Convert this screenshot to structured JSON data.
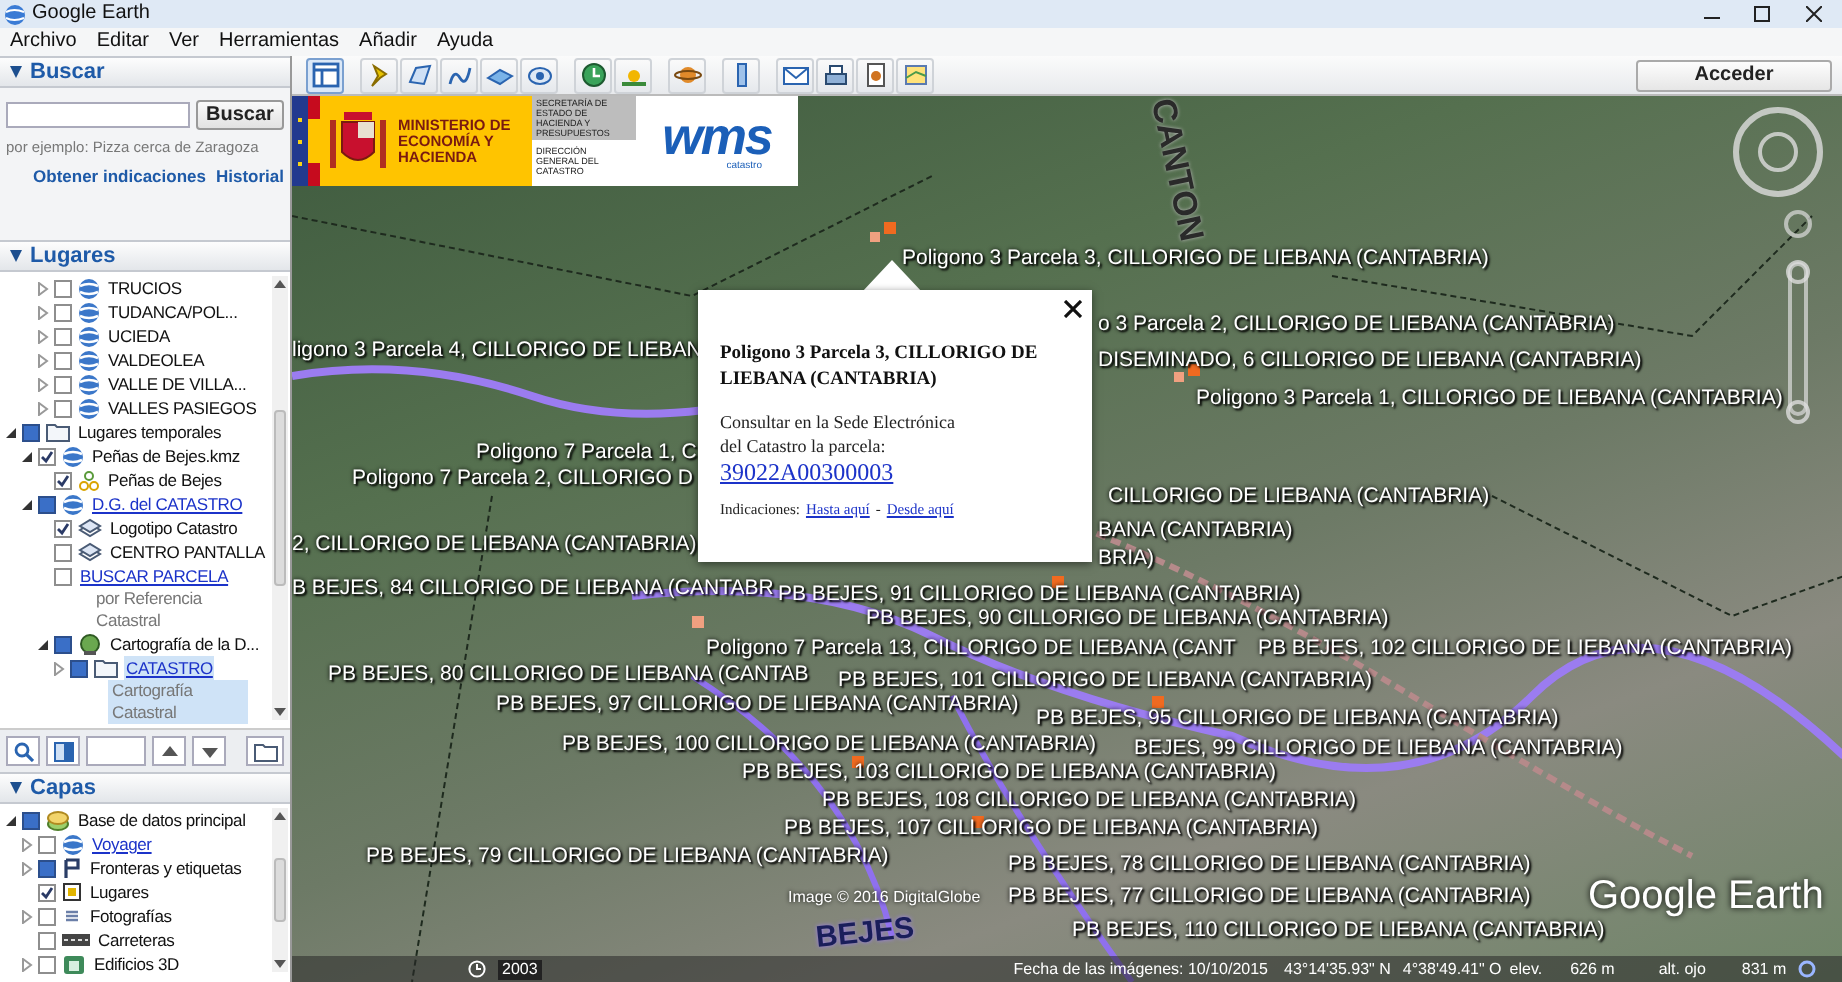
{
  "window": {
    "title": "Google Earth"
  },
  "menu": [
    "Archivo",
    "Editar",
    "Ver",
    "Herramientas",
    "Añadir",
    "Ayuda"
  ],
  "toolbar": {
    "sidebar_selected": true
  },
  "account_button": "Acceder",
  "search": {
    "title": "Buscar",
    "expanded": true,
    "button": "Buscar",
    "hint": "por ejemplo: Pizza cerca de Zaragoza",
    "links": [
      "Obtener indicaciones",
      "Historial"
    ]
  },
  "places": {
    "title": "Lugares",
    "expanded": true,
    "scrolled_children": [
      {
        "label": "TRUCIOS",
        "kind": "kml",
        "checked": false,
        "expanded": false
      },
      {
        "label": "TUDANCA/POL...",
        "kind": "kml",
        "checked": false,
        "expanded": false
      },
      {
        "label": "UCIEDA",
        "kind": "kml",
        "checked": false,
        "expanded": false
      },
      {
        "label": "VALDEOLEA",
        "kind": "kml",
        "checked": false,
        "expanded": false
      },
      {
        "label": "VALLE DE VILLA...",
        "kind": "kml",
        "checked": false,
        "expanded": false
      },
      {
        "label": "VALLES PASIEGOS",
        "kind": "kml",
        "checked": false,
        "expanded": false
      }
    ],
    "tree": [
      {
        "label": "Lugares temporales",
        "kind": "folder",
        "mixed": true,
        "expanded": true,
        "link": false,
        "selected": false,
        "children": [
          {
            "label": "Peñas de Bejes.kmz",
            "kind": "kml",
            "checked": true,
            "expanded": true,
            "link": false,
            "selected": false,
            "children": [
              {
                "label": "Peñas de Bejes",
                "kind": "points",
                "checked": true,
                "link": false,
                "selected": false
              }
            ]
          },
          {
            "label": "D.G. del CATASTRO",
            "kind": "kml",
            "mixed": true,
            "expanded": true,
            "link": true,
            "selected": false,
            "children": [
              {
                "label": "Logotipo Catastro",
                "kind": "overlay",
                "checked": true,
                "link": false,
                "selected": false
              },
              {
                "label": "CENTRO PANTALLA",
                "kind": "overlay",
                "checked": false,
                "link": false,
                "selected": false
              },
              {
                "label": "BUSCAR PARCELA",
                "kind": "none",
                "checked": false,
                "link": true,
                "selected": false,
                "description": "por Referencia Catastral"
              },
              {
                "label": "Cartografía de la D...",
                "kind": "wms",
                "mixed": true,
                "expanded": true,
                "link": false,
                "selected": false,
                "children": [
                  {
                    "label": "CATASTRO",
                    "kind": "folder",
                    "mixed": true,
                    "expanded": false,
                    "link": true,
                    "selected": true,
                    "description": "Cartografía Catastral"
                  }
                ]
              }
            ]
          }
        ]
      }
    ]
  },
  "layers": {
    "title": "Capas",
    "expanded": true,
    "tree": [
      {
        "label": "Base de datos principal",
        "kind": "layers",
        "mixed": true,
        "expanded": true,
        "link": false,
        "selected": false,
        "children": [
          {
            "label": "Voyager",
            "kind": "kml",
            "checked": false,
            "expanded": false,
            "link": true,
            "selected": false
          },
          {
            "label": "Fronteras y etiquetas",
            "kind": "borders",
            "mixed": true,
            "expanded": false,
            "link": false,
            "selected": false
          },
          {
            "label": "Lugares",
            "kind": "places",
            "checked": true,
            "link": false,
            "selected": false
          },
          {
            "label": "Fotografías",
            "kind": "photos",
            "checked": false,
            "expanded": false,
            "link": false,
            "selected": false
          },
          {
            "label": "Carreteras",
            "kind": "roads",
            "checked": false,
            "link": false,
            "selected": false
          },
          {
            "label": "Edificios 3D",
            "kind": "buildings",
            "checked": false,
            "expanded": false,
            "link": false,
            "selected": false
          }
        ]
      }
    ]
  },
  "logo": {
    "ministry": "MINISTERIO DE ECONOMÍA Y HACIENDA",
    "secretariat": "SECRETARÍA DE ESTADO DE HACIENDA Y PRESUPUESTOS",
    "directorate": "DIRECCIÓN GENERAL DEL CATASTRO",
    "wms": "wms",
    "wms_sub": "catastro"
  },
  "map": {
    "big_labels": [
      "CANTON",
      "BEJES"
    ],
    "labels": [
      "Poligono 3 Parcela 3, CILLORIGO DE LIEBANA (CANTABRIA)",
      "o 3 Parcela 2, CILLORIGO DE LIEBANA (CANTABRIA)",
      "DISEMINADO, 6  CILLORIGO DE LIEBANA (CANTABRIA)",
      "Poligono 3 Parcela 1, CILLORIGO DE LIEBANA (CANTABRIA)",
      "ligono 3 Parcela 4, CILLORIGO DE LIEBAN",
      "Poligono 7 Parcela 1, C",
      "Poligono 7 Parcela 2, CILLORIGO D",
      "2, CILLORIGO DE LIEBANA (CANTABRIA)",
      "CILLORIGO DE LIEBANA (CANTABRIA)",
      "BANA (CANTABRIA)",
      "BRIA)",
      "B BEJES, 84  CILLORIGO DE LIEBANA (CANTABR",
      "PB BEJES, 91  CILLORIGO DE LIEBANA (CANTABRIA)",
      "PB BEJES, 90  CILLORIGO DE LIEBANA (CANTABRIA)",
      "Poligono 7 Parcela 13, CILLORIGO DE LIEBANA (CANT",
      "PB BEJES, 102  CILLORIGO DE LIEBANA (CANTABRIA)",
      "PB BEJES, 80  CILLORIGO DE LIEBANA (CANTAB",
      "PB BEJES, 101  CILLORIGO DE LIEBANA (CANTABRIA)",
      "PB BEJES, 97  CILLORIGO DE LIEBANA (CANTABRIA)",
      "PB BEJES, 95  CILLORIGO DE LIEBANA (CANTABRIA)",
      "PB BEJES, 100  CILLORIGO DE LIEBANA (CANTABRIA)",
      "BEJES, 99  CILLORIGO DE LIEBANA (CANTABRIA)",
      "PB BEJES, 103  CILLORIGO DE LIEBANA (CANTABRIA)",
      "PB BEJES, 108  CILLORIGO DE LIEBANA (CANTABRIA)",
      "PB BEJES, 107  CILLORIGO DE LIEBANA (CANTABRIA)",
      "PB BEJES, 79  CILLORIGO DE LIEBANA (CANTABRIA)",
      "PB BEJES, 78  CILLORIGO DE LIEBANA (CANTABRIA)",
      "PB BEJES, 77  CILLORIGO DE LIEBANA (CANTABRIA)",
      "PB BEJES, 110  CILLORIGO DE LIEBANA (CANTABRIA)"
    ],
    "copyright": "Image © 2016 DigitalGlobe",
    "brand": "Google Earth"
  },
  "popup": {
    "title": "Poligono 3 Parcela 3, CILLORIGO DE LIEBANA (CANTABRIA)",
    "text": "Consultar en la Sede Electrónica del Catastro la parcela:",
    "link": "39022A00300003",
    "directions_label": "Indicaciones:",
    "directions": [
      "Hasta aquí",
      "Desde aquí"
    ],
    "separator": "-"
  },
  "status_bar": {
    "timeline_year": "2003",
    "imagery_date": "Fecha de las imágenes: 10/10/2015",
    "latitude": "43°14'35.93\" N",
    "longitude": "4°38'49.41\" O",
    "elevation_label": "elev.",
    "elevation": "626 m",
    "eye_alt_label": "alt. ojo",
    "eye_alt": "831 m"
  }
}
